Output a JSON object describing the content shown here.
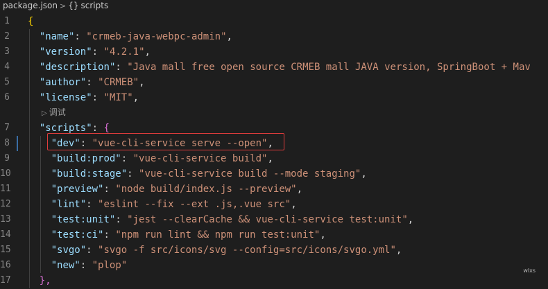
{
  "breadcrumb": {
    "file": "package.json",
    "separator": ">",
    "icon": "{}",
    "section": "scripts"
  },
  "codelens": {
    "label": "调试"
  },
  "lines": [
    {
      "num": "1",
      "indent": 0,
      "key": "",
      "sep": "",
      "value": "",
      "suffix": "{"
    },
    {
      "num": "2",
      "indent": 1,
      "key": "\"name\"",
      "sep": ": ",
      "value": "\"crmeb-java-webpc-admin\"",
      "suffix": ","
    },
    {
      "num": "3",
      "indent": 1,
      "key": "\"version\"",
      "sep": ": ",
      "value": "\"4.2.1\"",
      "suffix": ","
    },
    {
      "num": "4",
      "indent": 1,
      "key": "\"description\"",
      "sep": ": ",
      "value": "\"Java mall free open source CRMEB mall JAVA version, SpringBoot + Mav",
      "suffix": ""
    },
    {
      "num": "5",
      "indent": 1,
      "key": "\"author\"",
      "sep": ": ",
      "value": "\"CRMEB\"",
      "suffix": ","
    },
    {
      "num": "6",
      "indent": 1,
      "key": "\"license\"",
      "sep": ": ",
      "value": "\"MIT\"",
      "suffix": ","
    },
    {
      "num": "7",
      "indent": 1,
      "key": "\"scripts\"",
      "sep": ": ",
      "value": "",
      "suffix": "{"
    },
    {
      "num": "8",
      "indent": 2,
      "key": "\"dev\"",
      "sep": ": ",
      "value": "\"vue-cli-service serve --open\"",
      "suffix": ","
    },
    {
      "num": "9",
      "indent": 2,
      "key": "\"build:prod\"",
      "sep": ": ",
      "value": "\"vue-cli-service build\"",
      "suffix": ","
    },
    {
      "num": "10",
      "indent": 2,
      "key": "\"build:stage\"",
      "sep": ": ",
      "value": "\"vue-cli-service build --mode staging\"",
      "suffix": ","
    },
    {
      "num": "11",
      "indent": 2,
      "key": "\"preview\"",
      "sep": ": ",
      "value": "\"node build/index.js --preview\"",
      "suffix": ","
    },
    {
      "num": "12",
      "indent": 2,
      "key": "\"lint\"",
      "sep": ": ",
      "value": "\"eslint --fix --ext .js,.vue src\"",
      "suffix": ","
    },
    {
      "num": "13",
      "indent": 2,
      "key": "\"test:unit\"",
      "sep": ": ",
      "value": "\"jest --clearCache && vue-cli-service test:unit\"",
      "suffix": ","
    },
    {
      "num": "14",
      "indent": 2,
      "key": "\"test:ci\"",
      "sep": ": ",
      "value": "\"npm run lint && npm run test:unit\"",
      "suffix": ","
    },
    {
      "num": "15",
      "indent": 2,
      "key": "\"svgo\"",
      "sep": ": ",
      "value": "\"svgo -f src/icons/svg --config=src/icons/svgo.yml\"",
      "suffix": ","
    },
    {
      "num": "16",
      "indent": 2,
      "key": "\"new\"",
      "sep": ": ",
      "value": "\"plop\"",
      "suffix": ""
    },
    {
      "num": "17",
      "indent": 1,
      "key": "",
      "sep": "",
      "value": "",
      "suffix": "},"
    }
  ],
  "watermark": "wlxs",
  "colors": {
    "background": "#1e1e1e",
    "key": "#9cdcfe",
    "string": "#ce9178",
    "highlight_border": "#e03c3c"
  }
}
